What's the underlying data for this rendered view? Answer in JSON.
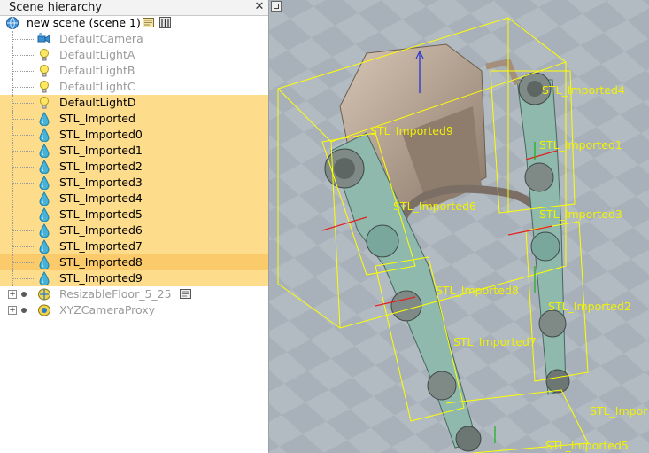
{
  "panel": {
    "title": "Scene hierarchy",
    "close_glyph": "✕",
    "root": {
      "label": "new scene (scene 1)",
      "icon": "globe-icon"
    },
    "items": [
      {
        "label": "DefaultCamera",
        "icon": "camera-icon",
        "style": "dim",
        "state": "normal"
      },
      {
        "label": "DefaultLightA",
        "icon": "light-bulb-icon",
        "style": "dim",
        "state": "normal"
      },
      {
        "label": "DefaultLightB",
        "icon": "light-bulb-icon",
        "style": "dim",
        "state": "normal"
      },
      {
        "label": "DefaultLightC",
        "icon": "light-bulb-icon",
        "style": "dim",
        "state": "normal"
      },
      {
        "label": "DefaultLightD",
        "icon": "light-bulb-icon",
        "style": "bold",
        "state": "selected"
      },
      {
        "label": "STL_Imported",
        "icon": "shape-drop-icon",
        "style": "bold",
        "state": "selected"
      },
      {
        "label": "STL_Imported0",
        "icon": "shape-drop-icon",
        "style": "bold",
        "state": "selected"
      },
      {
        "label": "STL_Imported1",
        "icon": "shape-drop-icon",
        "style": "bold",
        "state": "selected"
      },
      {
        "label": "STL_Imported2",
        "icon": "shape-drop-icon",
        "style": "bold",
        "state": "selected"
      },
      {
        "label": "STL_Imported3",
        "icon": "shape-drop-icon",
        "style": "bold",
        "state": "selected"
      },
      {
        "label": "STL_Imported4",
        "icon": "shape-drop-icon",
        "style": "bold",
        "state": "selected"
      },
      {
        "label": "STL_Imported5",
        "icon": "shape-drop-icon",
        "style": "bold",
        "state": "selected"
      },
      {
        "label": "STL_Imported6",
        "icon": "shape-drop-icon",
        "style": "bold",
        "state": "selected"
      },
      {
        "label": "STL_Imported7",
        "icon": "shape-drop-icon",
        "style": "bold",
        "state": "selected"
      },
      {
        "label": "STL_Imported8",
        "icon": "shape-drop-icon",
        "style": "bold",
        "state": "current"
      },
      {
        "label": "STL_Imported9",
        "icon": "shape-drop-icon",
        "style": "bold",
        "state": "selected"
      },
      {
        "label": "ResizableFloor_5_25",
        "icon": "floor-model-icon",
        "style": "dim",
        "state": "normal",
        "expandable": true
      },
      {
        "label": "XYZCameraProxy",
        "icon": "camera-proxy-icon",
        "style": "dim",
        "state": "normal",
        "expandable": true
      }
    ]
  },
  "viewport": {
    "labels": [
      "STL_Imported4",
      "STL_Imported9",
      "STL_Imported1",
      "STL_Imported6",
      "STL_Imported3",
      "STL_Imported8",
      "STL_Imported2",
      "STL_Imported7",
      "STL_Impor",
      "STL_Imported5"
    ],
    "label_color": "#f2f200",
    "bbox_color": "#ffff00",
    "floor_color": "#b4bcc3"
  },
  "colors": {
    "selection": "#fddd8b",
    "current_selection": "#fbca6a"
  }
}
